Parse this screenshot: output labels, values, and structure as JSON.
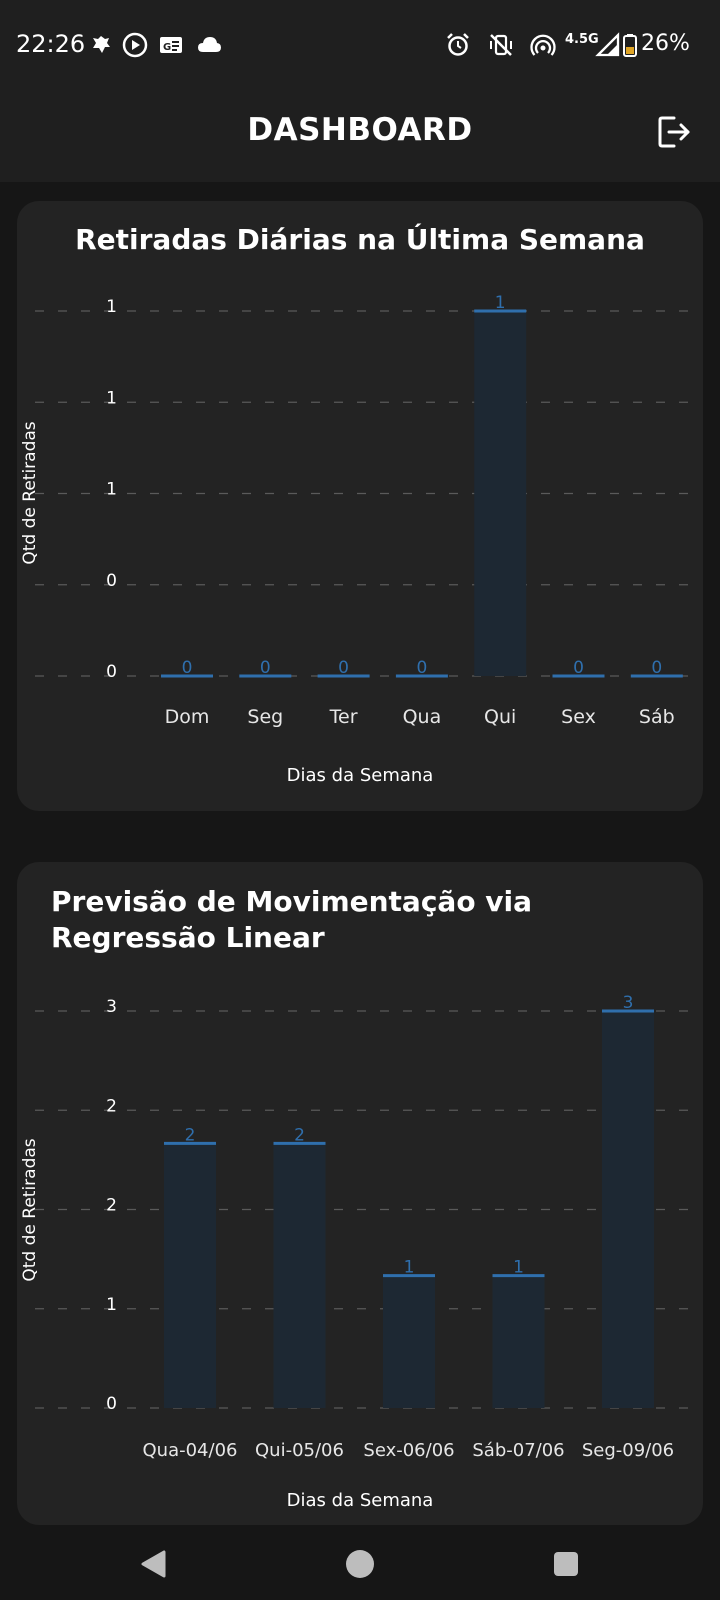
{
  "status_bar": {
    "time": "22:26",
    "network": "4.5G",
    "battery": "26%"
  },
  "header": {
    "title": "DASHBOARD",
    "logout_icon": "logout-icon"
  },
  "colors": {
    "bar_fill": "#1d2833",
    "bar_line": "#2f6fad",
    "label_blue": "#2f6fad",
    "card_bg": "#232323",
    "header_bg": "#1f1f1f"
  },
  "charts": [
    {
      "card_title": "Retiradas Diárias na Última Semana",
      "chart_data": {
        "type": "bar",
        "title": "Retiradas Diárias na Última Semana",
        "xlabel": "Dias da Semana",
        "ylabel": "Qtd de Retiradas",
        "categories": [
          "Dom",
          "Seg",
          "Ter",
          "Qua",
          "Qui",
          "Sex",
          "Sáb"
        ],
        "values": [
          0,
          0,
          0,
          0,
          1,
          0,
          0
        ],
        "value_labels": [
          "0",
          "0",
          "0",
          "0",
          "1",
          "0",
          "0"
        ],
        "y_ticks": [
          0,
          0.25,
          0.5,
          0.75,
          1
        ],
        "y_tick_labels": [
          "0",
          "0",
          "1",
          "1",
          "1"
        ],
        "ylim": [
          0,
          1
        ],
        "grid": true
      }
    },
    {
      "card_title": "Previsão de Movimentação via Regressão Linear",
      "chart_data": {
        "type": "bar",
        "title": "Previsão de Movimentação via Regressão Linear",
        "xlabel": "Dias da Semana",
        "ylabel": "Qtd de Retiradas",
        "categories": [
          "Qua-04/06",
          "Qui-05/06",
          "Sex-06/06",
          "Sáb-07/06",
          "Seg-09/06"
        ],
        "values": [
          2.0,
          2.0,
          1.0,
          1.0,
          3.0
        ],
        "value_labels": [
          "2",
          "2",
          "1",
          "1",
          "3"
        ],
        "y_ticks": [
          0,
          0.75,
          1.5,
          2.25,
          3
        ],
        "y_tick_labels": [
          "0",
          "1",
          "2",
          "2",
          "3"
        ],
        "ylim": [
          0,
          3
        ],
        "grid": true
      }
    }
  ],
  "nav_bar": {
    "back_icon": "back-triangle-icon",
    "home_icon": "home-circle-icon",
    "recents_icon": "recents-square-icon"
  }
}
